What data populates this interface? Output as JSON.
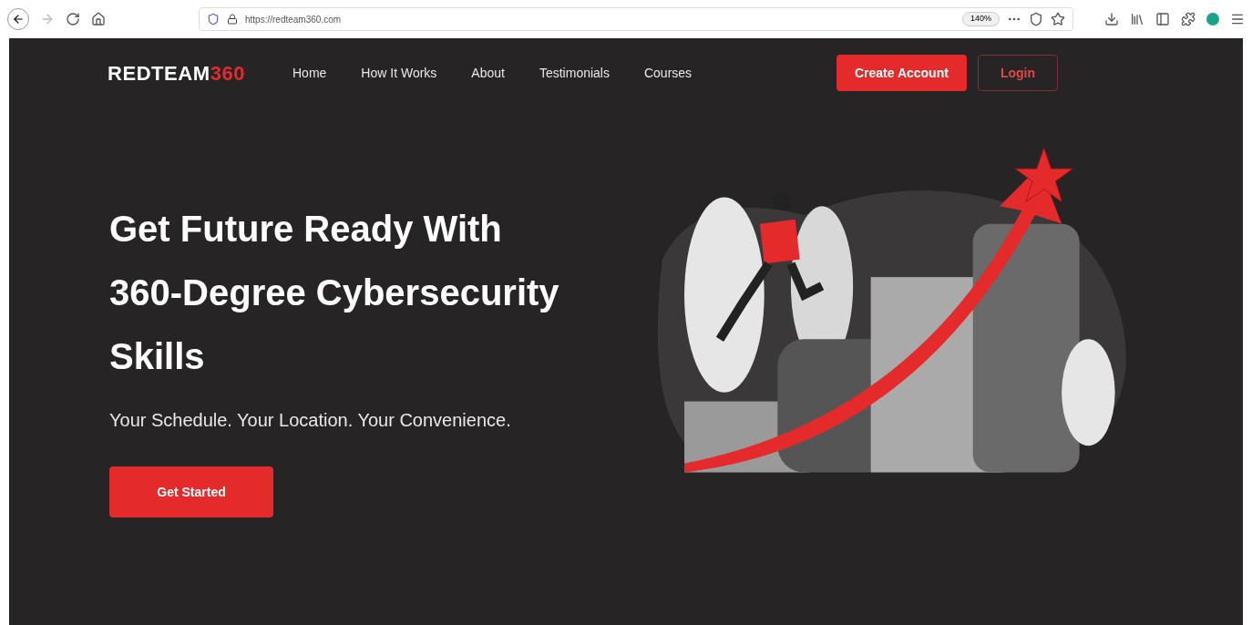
{
  "browser": {
    "url": "https://redteam360.com",
    "zoom": "140%"
  },
  "header": {
    "logo": {
      "primary": "REDTEAM",
      "accent": "360"
    },
    "nav": [
      "Home",
      "How It Works",
      "About",
      "Testimonials",
      "Courses"
    ],
    "buttons": [
      {
        "label": "Create Account",
        "kind": "primary"
      },
      {
        "label": "Login",
        "kind": "outline"
      }
    ]
  },
  "hero": {
    "heading": [
      "Get Future Ready With",
      "360-Degree Cybersecurity",
      "Skills"
    ],
    "subtitle": "Your Schedule. Your Location. Your Convenience.",
    "cta": "Get Started"
  }
}
